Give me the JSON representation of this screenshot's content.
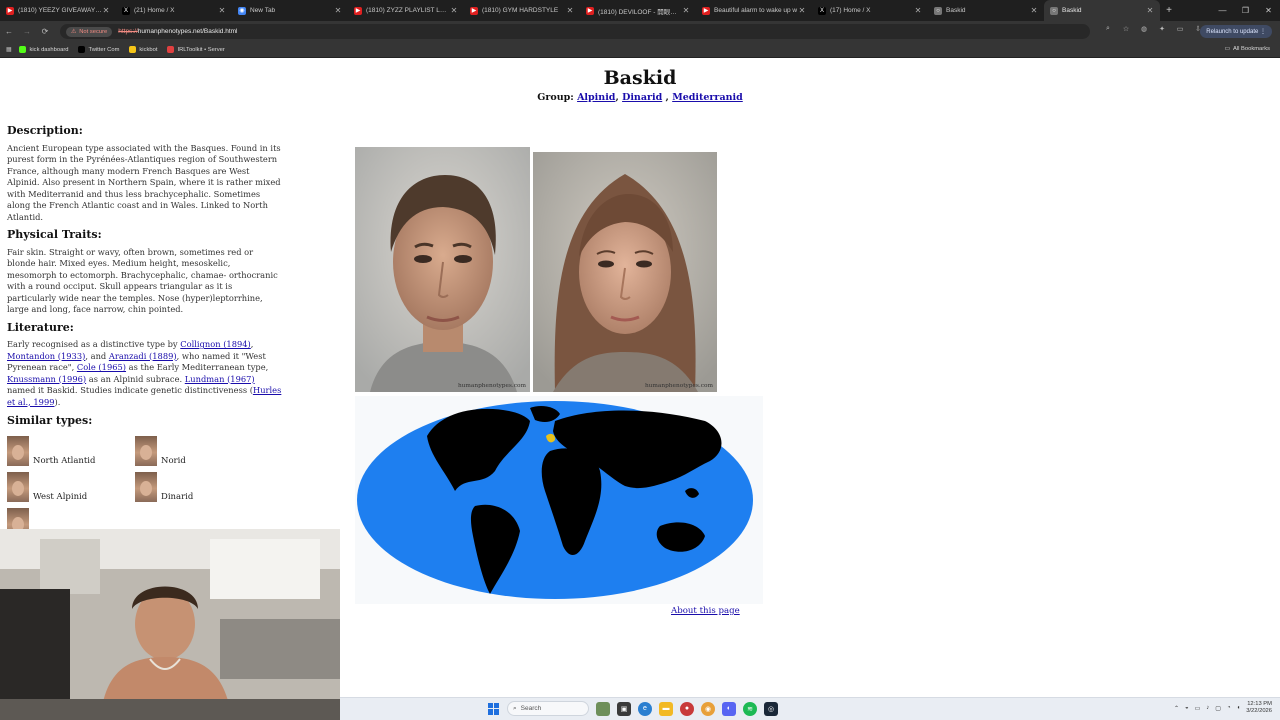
{
  "browser": {
    "tabs": [
      {
        "label": "(1810) YEEZY GIVEAWAY!!! | 6",
        "favicon": "youtube-icon"
      },
      {
        "label": "(21) Home / X",
        "favicon": "x-icon"
      },
      {
        "label": "New Tab",
        "favicon": "chrome-icon"
      },
      {
        "label": "(1810) ZYZZ PLAYLIST LEGEN",
        "favicon": "youtube-icon"
      },
      {
        "label": "(1810) GYM HARDSTYLE",
        "favicon": "youtube-icon"
      },
      {
        "label": "(1810) DEVILOOF - 開眼裝置",
        "favicon": "youtube-icon"
      },
      {
        "label": "Beautiful alarm to wake up w",
        "favicon": "youtube-icon"
      },
      {
        "label": "(17) Home / X",
        "favicon": "x-icon"
      },
      {
        "label": "Baskid",
        "favicon": "globe-icon"
      },
      {
        "label": "Baskid",
        "favicon": "globe-icon",
        "active": true
      }
    ],
    "address": {
      "security": "Not secure",
      "scheme": "https://",
      "rest": "humanphenotypes.net/Baskid.html"
    },
    "relaunch": "Relaunch to update",
    "bookmarks": [
      {
        "label": "kick dashboard",
        "color": "#53fc18"
      },
      {
        "label": "Twitter Com",
        "color": "#000000"
      },
      {
        "label": "kickbot",
        "color": "#f5c518"
      },
      {
        "label": "IRLToolkit • Server",
        "color": "#e04040"
      }
    ],
    "all_bookmarks": "All Bookmarks"
  },
  "page": {
    "title": "Baskid",
    "group_label": "Group:",
    "groups": [
      "Alpinid",
      "Dinarid",
      "Mediterranid"
    ],
    "description_heading": "Description:",
    "description": "Ancient European type associated with the Basques. Found in its purest form in the Pyrénées-Atlantiques region of Southwestern France, although many modern French Basques are West Alpinid. Also present in Northern Spain, where it is rather mixed with Mediterranid and thus less brachycephalic. Sometimes along the French Atlantic coast and in Wales. Linked to North Atlantid.",
    "traits_heading": "Physical Traits:",
    "traits": "Fair skin. Straight or wavy, often brown, sometimes red or blonde hair. Mixed eyes. Medium height, mesoskelic, mesomorph to ectomorph. Brachycephalic, chamae- orthocranic with a round occiput. Skull appears triangular as it is particularly wide near the temples. Nose (hyper)leptorrhine, large and long, face narrow, chin pointed.",
    "literature_heading": "Literature:",
    "literature": {
      "t1": "Early recognised as a distinctive type by ",
      "l1": "Collignon (1894)",
      "t2": ", ",
      "l2": "Montandon (1933)",
      "t3": ", and ",
      "l3": "Aranzadi (1889)",
      "t4": ", who named it \"West Pyrenean race\", ",
      "l4": "Cole (1965)",
      "t5": " as the Early Mediterranean type, ",
      "l5": "Knussmann (1996)",
      "t6": " as an Alpinid subrace. ",
      "l6": "Lundman (1967)",
      "t7": " named it Baskid. Studies indicate genetic distinctiveness (",
      "l7": "Hurles et al., 1999",
      "t8": ")."
    },
    "similar_heading": "Similar types:",
    "similar": [
      "North Atlantid",
      "Norid",
      "West Alpinid",
      "Dinarid"
    ],
    "watermark_male": "humanphenotypes.com",
    "watermark_female": "humanphenotypes.com",
    "about": "About this page",
    "map_colors": {
      "ocean": "#1e7ff0",
      "land": "#000000",
      "highlight": "#e8c21a"
    }
  },
  "taskbar": {
    "search": "Search",
    "time": "12:13 PM",
    "date": "3/22/2026"
  }
}
